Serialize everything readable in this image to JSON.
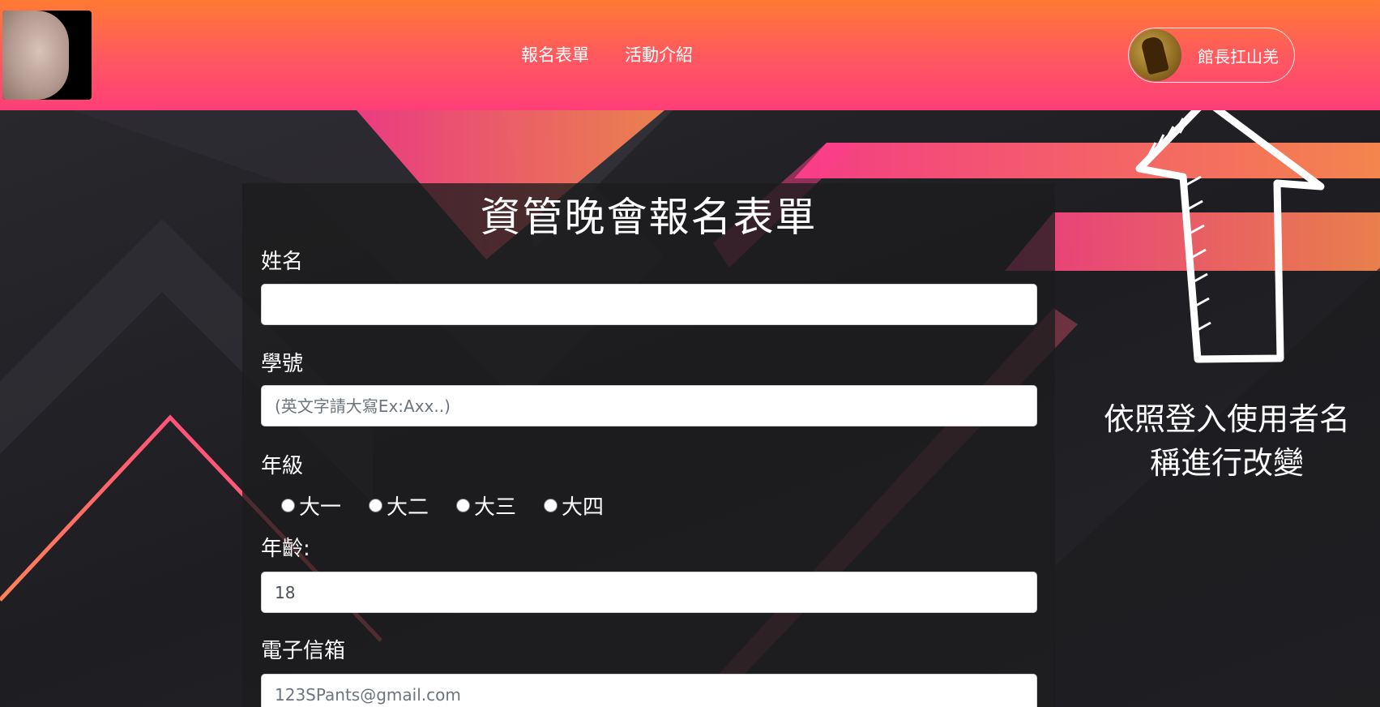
{
  "header": {
    "logo_alt": "site logo",
    "nav": [
      {
        "label": "報名表單"
      },
      {
        "label": "活動介紹"
      }
    ],
    "user": {
      "name": "館長扛山羌"
    }
  },
  "form": {
    "title": "資管晚會報名表單",
    "name": {
      "label": "姓名",
      "value": "",
      "placeholder": ""
    },
    "student_id": {
      "label": "學號",
      "value": "",
      "placeholder": "(英文字請大寫Ex:Axx..)"
    },
    "grade": {
      "label": "年級",
      "options": [
        "大一",
        "大二",
        "大三",
        "大四"
      ],
      "selected": null
    },
    "age": {
      "label": "年齡:",
      "value": "18"
    },
    "email": {
      "label": "電子信箱",
      "value": "",
      "placeholder": "123SPants@gmail.com"
    }
  },
  "hint": {
    "line1": "依照登入使用者名",
    "line2": "稱進行改變"
  },
  "colors": {
    "header_top": "#ff7a33",
    "header_bottom": "#ff3e78",
    "accent_pink": "#ff4f8a",
    "accent_orange": "#ff8a50"
  }
}
